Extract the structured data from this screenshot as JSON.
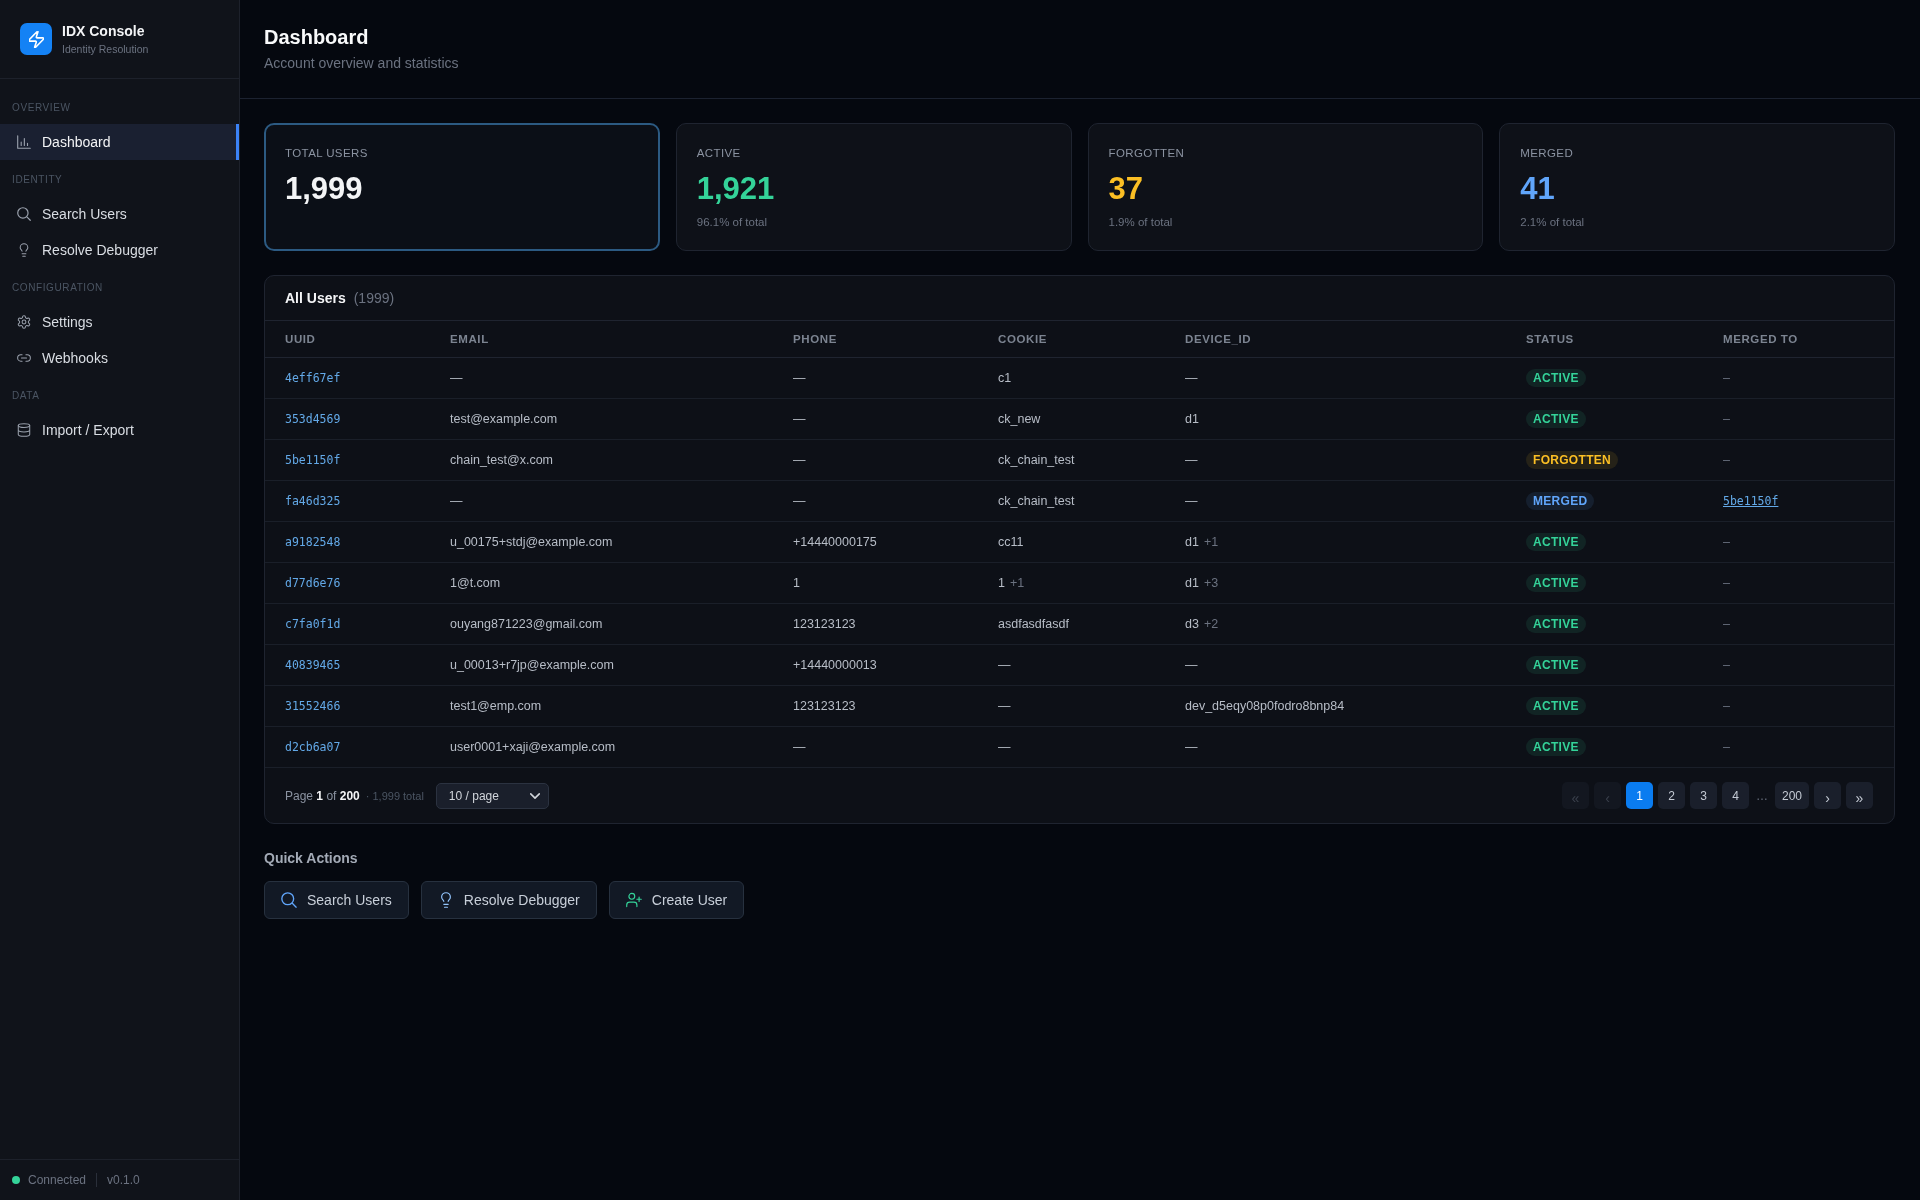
{
  "sidebar": {
    "brand": {
      "title": "IDX Console",
      "subtitle": "Identity Resolution"
    },
    "sections": [
      {
        "label": "OVERVIEW",
        "items": [
          {
            "label": "Dashboard",
            "selected": true
          }
        ]
      },
      {
        "label": "IDENTITY",
        "items": [
          {
            "label": "Search Users",
            "selected": false
          },
          {
            "label": "Resolve Debugger",
            "selected": false
          }
        ]
      },
      {
        "label": "CONFIGURATION",
        "items": [
          {
            "label": "Settings",
            "selected": false
          },
          {
            "label": "Webhooks",
            "selected": false
          }
        ]
      },
      {
        "label": "DATA",
        "items": [
          {
            "label": "Import / Export",
            "selected": false
          }
        ]
      }
    ],
    "footer": {
      "status": "Connected",
      "connected": true,
      "version": "v0.1.0"
    }
  },
  "header": {
    "title": "Dashboard",
    "subtitle": "Account overview and statistics"
  },
  "stats": [
    {
      "label": "TOTAL USERS",
      "value": "1,999",
      "color": "#f3f4f6",
      "selected": true
    },
    {
      "label": "ACTIVE",
      "value": "1,921",
      "note": "96.1% of total",
      "color": "#34d399",
      "selected": false
    },
    {
      "label": "FORGOTTEN",
      "value": "37",
      "note": "1.9% of total",
      "color": "#fbbf24",
      "selected": false
    },
    {
      "label": "MERGED",
      "value": "41",
      "note": "2.1% of total",
      "color": "#60a5fa",
      "selected": false
    }
  ],
  "users_table": {
    "title": "All Users",
    "count": "(1999)",
    "columns": [
      "UUID",
      "EMAIL",
      "PHONE",
      "COOKIE",
      "DEVICE_ID",
      "STATUS",
      "MERGED TO"
    ],
    "rows": [
      {
        "uuid": "4eff67ef",
        "email": "—",
        "phone": "—",
        "cookie": {
          "value": "c1"
        },
        "device_id": {
          "value": "—"
        },
        "status": {
          "label": "ACTIVE",
          "color": "#34d399"
        },
        "merged_to": {
          "text": "–",
          "kind": "none"
        }
      },
      {
        "uuid": "353d4569",
        "email": "test@example.com",
        "phone": "—",
        "cookie": {
          "value": "ck_new"
        },
        "device_id": {
          "value": "d1"
        },
        "status": {
          "label": "ACTIVE",
          "color": "#34d399"
        },
        "merged_to": {
          "text": "–",
          "kind": "none"
        }
      },
      {
        "uuid": "5be1150f",
        "email": "chain_test@x.com",
        "phone": "—",
        "cookie": {
          "value": "ck_chain_test"
        },
        "device_id": {
          "value": "—"
        },
        "status": {
          "label": "FORGOTTEN",
          "color": "#fbbf24"
        },
        "merged_to": {
          "text": "–",
          "kind": "none"
        }
      },
      {
        "uuid": "fa46d325",
        "email": "—",
        "phone": "—",
        "cookie": {
          "value": "ck_chain_test"
        },
        "device_id": {
          "value": "—"
        },
        "status": {
          "label": "MERGED",
          "color": "#60a5fa"
        },
        "merged_to": {
          "text": "5be1150f",
          "kind": "link"
        }
      },
      {
        "uuid": "a9182548",
        "email": "u_00175+stdj@example.com",
        "phone": "+14440000175",
        "cookie": {
          "value": "cc11"
        },
        "device_id": {
          "value": "d1",
          "extra": "+1"
        },
        "status": {
          "label": "ACTIVE",
          "color": "#34d399"
        },
        "merged_to": {
          "text": "–",
          "kind": "none"
        }
      },
      {
        "uuid": "d77d6e76",
        "email": "1@t.com",
        "phone": "1",
        "cookie": {
          "value": "1",
          "extra": "+1"
        },
        "device_id": {
          "value": "d1",
          "extra": "+3"
        },
        "status": {
          "label": "ACTIVE",
          "color": "#34d399"
        },
        "merged_to": {
          "text": "–",
          "kind": "none"
        }
      },
      {
        "uuid": "c7fa0f1d",
        "email": "ouyang871223@gmail.com",
        "phone": "123123123",
        "cookie": {
          "value": "asdfasdfasdf"
        },
        "device_id": {
          "value": "d3",
          "extra": "+2"
        },
        "status": {
          "label": "ACTIVE",
          "color": "#34d399"
        },
        "merged_to": {
          "text": "–",
          "kind": "none"
        }
      },
      {
        "uuid": "40839465",
        "email": "u_00013+r7jp@example.com",
        "phone": "+14440000013",
        "cookie": {
          "value": "—"
        },
        "device_id": {
          "value": "—"
        },
        "status": {
          "label": "ACTIVE",
          "color": "#34d399"
        },
        "merged_to": {
          "text": "–",
          "kind": "none"
        }
      },
      {
        "uuid": "31552466",
        "email": "test1@emp.com",
        "phone": "123123123",
        "cookie": {
          "value": "—"
        },
        "device_id": {
          "value": "dev_d5eqy08p0fodro8bnp84"
        },
        "status": {
          "label": "ACTIVE",
          "color": "#34d399"
        },
        "merged_to": {
          "text": "–",
          "kind": "none"
        }
      },
      {
        "uuid": "d2cb6a07",
        "email": "user0001+xaji@example.com",
        "phone": "—",
        "cookie": {
          "value": "—"
        },
        "device_id": {
          "value": "—"
        },
        "status": {
          "label": "ACTIVE",
          "color": "#34d399"
        },
        "merged_to": {
          "text": "–",
          "kind": "none"
        }
      }
    ],
    "pagination": {
      "summary": "Page **1** of **200**",
      "total": "· 1,999 total",
      "page_size": "10 / page",
      "pages": [
        {
          "label": "«",
          "kind": "nav",
          "selected": false,
          "disabled": true
        },
        {
          "label": "‹",
          "kind": "nav",
          "selected": false,
          "disabled": true
        },
        {
          "label": "1",
          "kind": "page",
          "selected": true,
          "disabled": false
        },
        {
          "label": "2",
          "kind": "page",
          "selected": false,
          "disabled": false
        },
        {
          "label": "3",
          "kind": "page",
          "selected": false,
          "disabled": false
        },
        {
          "label": "4",
          "kind": "page",
          "selected": false,
          "disabled": false
        },
        {
          "label": "…",
          "kind": "gap"
        },
        {
          "label": "200",
          "kind": "page",
          "selected": false,
          "disabled": false
        },
        {
          "label": "›",
          "kind": "nav",
          "selected": false,
          "disabled": false
        },
        {
          "label": "»",
          "kind": "nav",
          "selected": false,
          "disabled": false
        }
      ]
    }
  },
  "quick_actions": {
    "title": "Quick Actions",
    "buttons": [
      {
        "label": "Search Users"
      },
      {
        "label": "Resolve Debugger"
      },
      {
        "label": "Create User"
      }
    ]
  }
}
